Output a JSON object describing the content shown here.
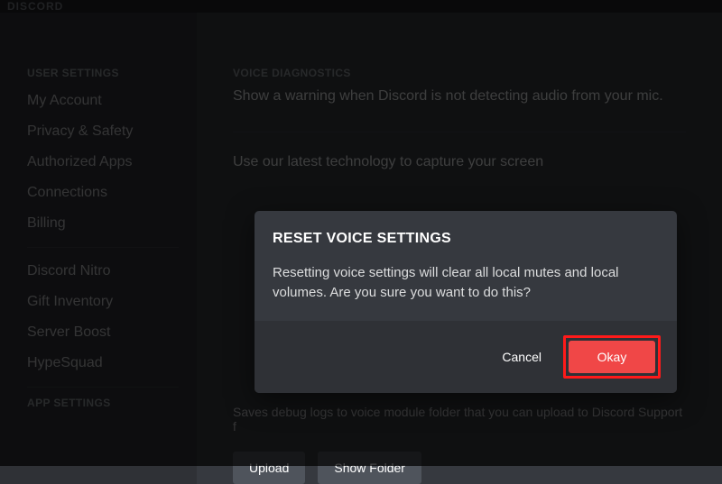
{
  "titlebar": {
    "wordmark": "DISCORD"
  },
  "sidebar": {
    "sections": [
      {
        "header": "USER SETTINGS",
        "items": [
          "My Account",
          "Privacy & Safety",
          "Authorized Apps",
          "Connections",
          "Billing",
          "Discord Nitro",
          "Gift Inventory",
          "Server Boost",
          "HypeSquad"
        ]
      },
      {
        "header": "APP SETTINGS",
        "items": []
      }
    ]
  },
  "main": {
    "voice_diagnostics_header": "VOICE DIAGNOSTICS",
    "mic_warning": "Show a warning when Discord is not detecting audio from your mic.",
    "screen_capture": "Use our latest technology to capture your screen",
    "debug_logs": "Saves debug logs to voice module folder that you can upload to Discord Support f",
    "upload_label": "Upload",
    "show_folder_label": "Show Folder"
  },
  "modal": {
    "title": "RESET VOICE SETTINGS",
    "body": "Resetting voice settings will clear all local mutes and local volumes. Are you sure you want to do this?",
    "cancel": "Cancel",
    "okay": "Okay"
  }
}
